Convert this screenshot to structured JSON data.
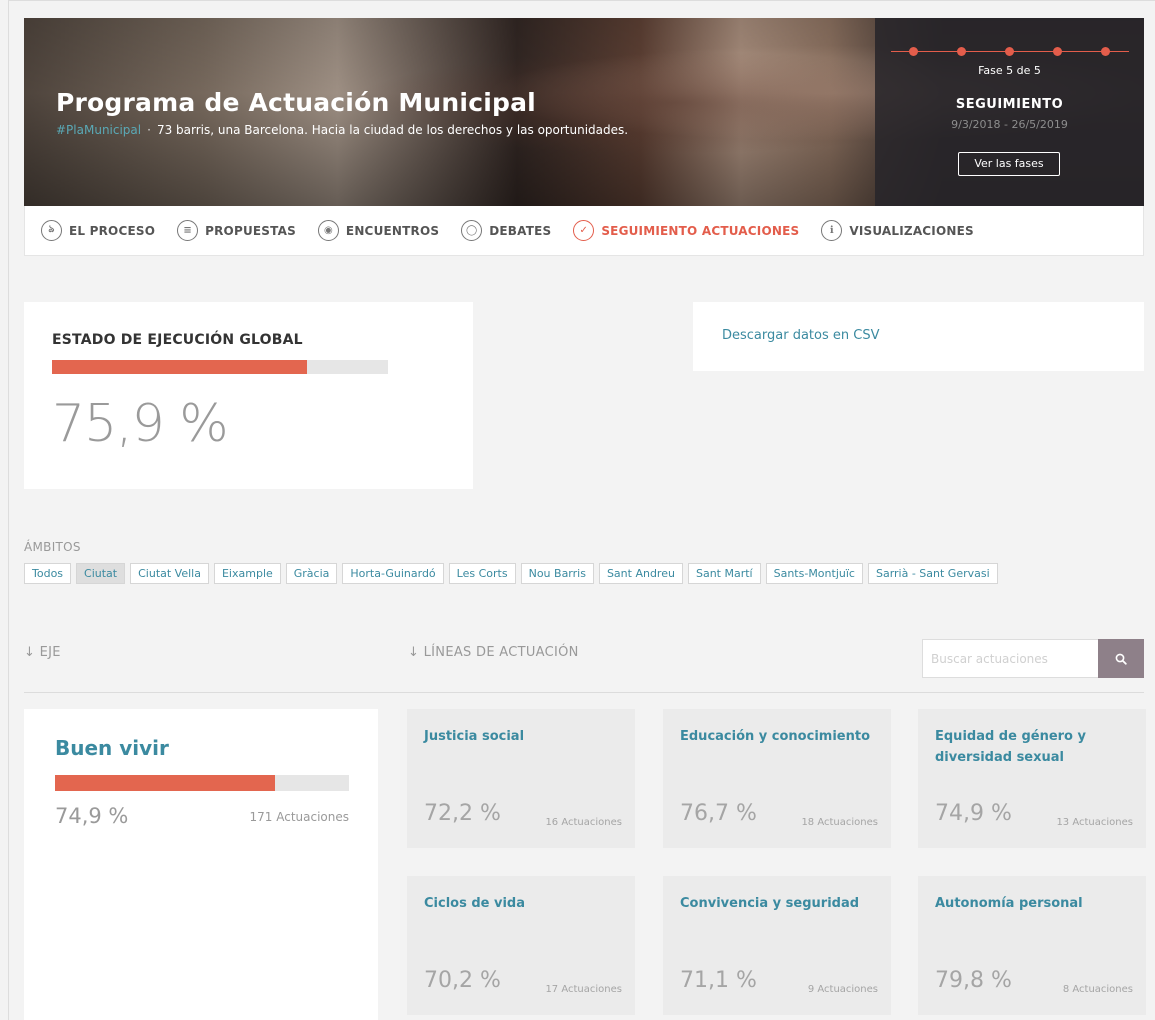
{
  "hero": {
    "title": "Programa de Actuación Municipal",
    "hashtag": "#PlaMunicipal",
    "separator": "·",
    "subtitle": "73 barris, una Barcelona. Hacia la ciudad de los derechos y las oportunidades.",
    "phase": {
      "count_label": "Fase 5 de 5",
      "current": 5,
      "total": 5,
      "name": "SEGUIMIENTO",
      "dates": "9/3/2018 - 26/5/2019",
      "button_label": "Ver las fases"
    }
  },
  "nav": {
    "items": [
      {
        "label": "EL PROCESO",
        "icon": "process-icon",
        "glyph": "ঌ"
      },
      {
        "label": "PROPUESTAS",
        "icon": "proposals-icon",
        "glyph": "≡"
      },
      {
        "label": "ENCUENTROS",
        "icon": "meetings-icon",
        "glyph": "◉"
      },
      {
        "label": "DEBATES",
        "icon": "debates-icon",
        "glyph": "◯"
      },
      {
        "label": "SEGUIMIENTO ACTUACIONES",
        "icon": "check-icon",
        "glyph": "✓"
      },
      {
        "label": "VISUALIZACIONES",
        "icon": "info-icon",
        "glyph": "ℹ"
      }
    ],
    "active_index": 4
  },
  "global": {
    "title": "ESTADO DE EJECUCIÓN GLOBAL",
    "percent_text": "75,9 %",
    "progress": 0.759
  },
  "csv": {
    "link_label": "Descargar datos en CSV"
  },
  "ambitos": {
    "label": "ÁMBITOS",
    "items": [
      "Todos",
      "Ciutat",
      "Ciutat Vella",
      "Eixample",
      "Gràcia",
      "Horta-Guinardó",
      "Les Corts",
      "Nou Barris",
      "Sant Andreu",
      "Sant Martí",
      "Sants-Montjuïc",
      "Sarrià - Sant Gervasi"
    ],
    "selected_index": 1
  },
  "headers": {
    "eje": "↓ EJE",
    "lineas": "↓ LÍNEAS DE ACTUACIÓN"
  },
  "search": {
    "placeholder": "Buscar actuaciones"
  },
  "eje_card": {
    "name": "Buen vivir",
    "percent_text": "74,9 %",
    "progress": 0.749,
    "count_text": "171 Actuaciones"
  },
  "lines": [
    {
      "title": "Justicia social",
      "percent_text": "72,2 %",
      "count_text": "16 Actuaciones"
    },
    {
      "title": "Educación y conocimiento",
      "percent_text": "76,7 %",
      "count_text": "18 Actuaciones"
    },
    {
      "title": "Equidad de género y diversidad sexual",
      "percent_text": "74,9 %",
      "count_text": "13 Actuaciones"
    },
    {
      "title": "Ciclos de vida",
      "percent_text": "70,2 %",
      "count_text": "17 Actuaciones"
    },
    {
      "title": "Convivencia y seguridad",
      "percent_text": "71,1 %",
      "count_text": "9 Actuaciones"
    },
    {
      "title": "Autonomía personal",
      "percent_text": "79,8 %",
      "count_text": "8 Actuaciones"
    }
  ],
  "colors": {
    "accent": "#e35d4b",
    "link": "#3b8aa0",
    "progress_fill": "#e3664f"
  }
}
